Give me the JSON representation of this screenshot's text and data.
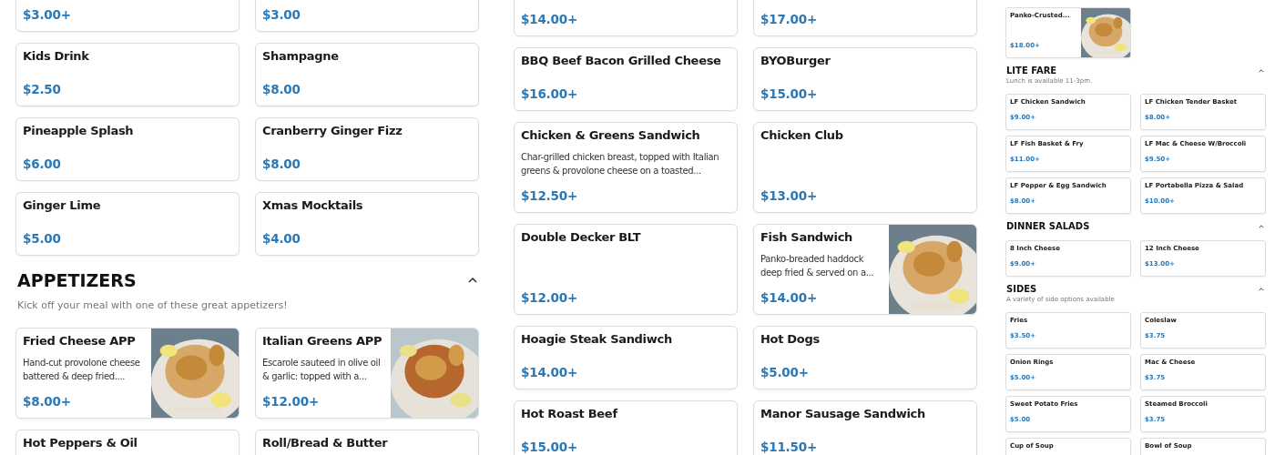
{
  "columns": [
    {
      "sections": [
        {
          "items": [
            {
              "price": "$3.00+"
            },
            {
              "price": "$3.00"
            }
          ]
        },
        {
          "items": [
            {
              "name": "Kids Drink",
              "price": "$2.50"
            },
            {
              "name": "Shampagne",
              "price": "$8.00"
            },
            {
              "name": "Pineapple Splash",
              "price": "$6.00"
            },
            {
              "name": "Cranberry Ginger Fizz",
              "price": "$8.00"
            },
            {
              "name": "Ginger Lime",
              "price": "$5.00"
            },
            {
              "name": "Xmas Mocktails",
              "price": "$4.00"
            }
          ]
        },
        {
          "title": "APPETIZERS",
          "description": "Kick off your meal with one of these great appetizers!",
          "expanded": true,
          "items": [
            {
              "name": "Fried Cheese APP",
              "description": "Hand-cut provolone cheese battered & deep fried....",
              "price": "$8.00+"
            },
            {
              "name": "Italian Greens APP",
              "description": "Escarole sauteed in olive oil & garlic: topped with a...",
              "price": "$12.00+"
            },
            {
              "name": "Hot Peppers & Oil"
            },
            {
              "name": "Roll/Bread & Butter"
            }
          ]
        }
      ]
    },
    {
      "sections": [
        {
          "items": [
            {
              "price": "$14.00+"
            },
            {
              "price": "$17.00+"
            },
            {
              "name": "BBQ Beef Bacon Grilled Cheese",
              "price": "$16.00+"
            },
            {
              "name": "BYOBurger",
              "price": "$15.00+"
            },
            {
              "name": "Chicken & Greens Sandwich",
              "description": "Char-grilled chicken breast, topped with Italian greens & provolone cheese on a toasted...",
              "price": "$12.50+"
            },
            {
              "name": "Chicken Club",
              "price": "$13.00+"
            },
            {
              "name": "Double Decker BLT",
              "price": "$12.00+"
            },
            {
              "name": "Fish Sandwich",
              "description": "Panko-breaded haddock deep fried & served on a...",
              "price": "$14.00+"
            },
            {
              "name": "Hoagie Steak Sandiwch",
              "price": "$14.00+"
            },
            {
              "name": "Hot Dogs",
              "price": "$5.00+"
            },
            {
              "name": "Hot Roast Beef",
              "price": "$15.00+"
            },
            {
              "name": "Manor Sausage Sandwich",
              "price": "$11.50+"
            }
          ]
        }
      ]
    },
    {
      "sections": [
        {
          "items": [
            {
              "name": "Panko-Crusted...",
              "price": "$18.00+"
            }
          ]
        },
        {
          "title": "LITE FARE",
          "description": "Lunch is available 11-3pm.",
          "expanded": true,
          "items": [
            {
              "name": "LF Chicken Sandwich",
              "price": "$9.00+"
            },
            {
              "name": "LF Chicken Tender Basket",
              "price": "$8.00+"
            },
            {
              "name": "LF Fish Basket & Fry",
              "price": "$11.00+"
            },
            {
              "name": "LF Mac & Cheese W/Broccoli",
              "price": "$9.50+"
            },
            {
              "name": "LF Pepper & Egg Sandwich",
              "price": "$8.00+"
            },
            {
              "name": "LF Portabella Pizza & Salad",
              "price": "$10.00+"
            }
          ]
        },
        {
          "title": "DINNER SALADS",
          "expanded": true,
          "items": [
            {
              "name": "8 Inch Cheese",
              "price": "$9.00+"
            },
            {
              "name": "12 Inch Cheese",
              "price": "$13.00+"
            }
          ]
        },
        {
          "title": "SIDES",
          "description": "A variety of side options available",
          "expanded": true,
          "items": [
            {
              "name": "Fries",
              "price": "$3.50+"
            },
            {
              "name": "Coleslaw",
              "price": "$3.75"
            },
            {
              "name": "Onion Rings",
              "price": "$5.00+"
            },
            {
              "name": "Mac & Cheese",
              "price": "$3.75"
            },
            {
              "name": "Sweet Potato Fries",
              "price": "$5.00"
            },
            {
              "name": "Steamed Broccoli",
              "price": "$3.75"
            },
            {
              "name": "Cup of Soup"
            },
            {
              "name": "Bowl of Soup"
            }
          ]
        }
      ]
    }
  ]
}
